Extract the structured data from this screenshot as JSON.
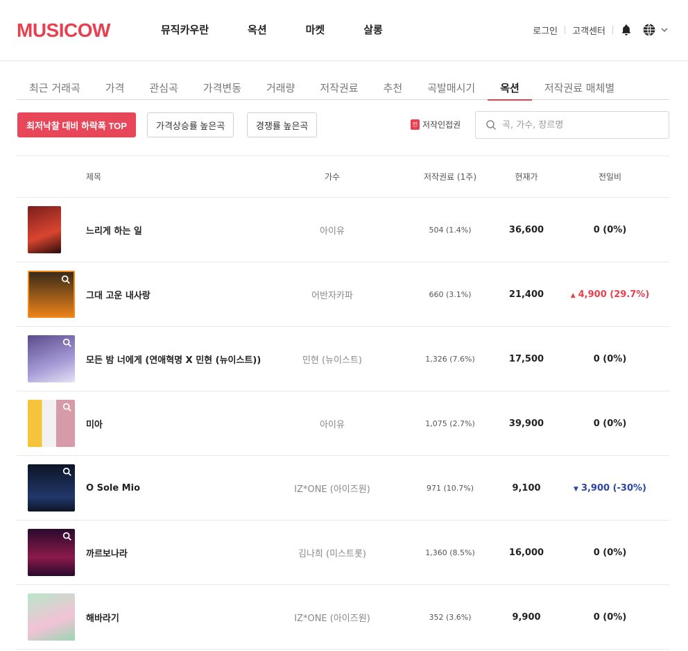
{
  "header": {
    "logo": "MUSICOW",
    "nav": [
      "뮤직카우란",
      "옥션",
      "마켓",
      "살롱"
    ],
    "util": {
      "login": "로그인",
      "support": "고객센터"
    }
  },
  "tabs": [
    {
      "label": "최근 거래곡",
      "active": false
    },
    {
      "label": "가격",
      "active": false
    },
    {
      "label": "관심곡",
      "active": false
    },
    {
      "label": "가격변동",
      "active": false
    },
    {
      "label": "거래량",
      "active": false
    },
    {
      "label": "저작권료",
      "active": false
    },
    {
      "label": "추천",
      "active": false
    },
    {
      "label": "곡발매시기",
      "active": false
    },
    {
      "label": "옥션",
      "active": true
    },
    {
      "label": "저작권료 매체별",
      "active": false
    }
  ],
  "filters": {
    "primary": "최저낙찰 대비 하락폭 TOP",
    "second": "가격상승률 높은곡",
    "third": "경쟁률 높은곡",
    "copyright_badge": "인",
    "copyright_label": "저작인접권"
  },
  "search": {
    "placeholder": "곡, 가수, 장르명"
  },
  "table": {
    "headers": {
      "title": "제목",
      "artist": "가수",
      "royalty": "저작권료 (1주)",
      "price": "현재가",
      "change": "전일비"
    },
    "rows": [
      {
        "title": "느리게 하는 일",
        "artist": "아이유",
        "royalty": "504 (1.4%)",
        "price": "36,600",
        "change": "0 (0%)",
        "dir": "flat"
      },
      {
        "title": "그대 고운 내사랑",
        "artist": "어반자카파",
        "royalty": "660 (3.1%)",
        "price": "21,400",
        "change": "4,900 (29.7%)",
        "dir": "up"
      },
      {
        "title": "모든 밤 너에게 (연애혁명 X 민현 (뉴이스트))",
        "artist": "민현 (뉴이스트)",
        "royalty": "1,326 (7.6%)",
        "price": "17,500",
        "change": "0 (0%)",
        "dir": "flat"
      },
      {
        "title": "미아",
        "artist": "아이유",
        "royalty": "1,075 (2.7%)",
        "price": "39,900",
        "change": "0 (0%)",
        "dir": "flat"
      },
      {
        "title": "O Sole Mio",
        "artist": "IZ*ONE (아이즈원)",
        "royalty": "971 (10.7%)",
        "price": "9,100",
        "change": "3,900 (-30%)",
        "dir": "down"
      },
      {
        "title": "까르보나라",
        "artist": "김나희 (미스트롯)",
        "royalty": "1,360 (8.5%)",
        "price": "16,000",
        "change": "0 (0%)",
        "dir": "flat"
      },
      {
        "title": "해바라기",
        "artist": "IZ*ONE (아이즈원)",
        "royalty": "352 (3.6%)",
        "price": "9,900",
        "change": "0 (0%)",
        "dir": "flat"
      }
    ]
  },
  "colors": {
    "accent": "#e8404f",
    "down": "#2c44a8"
  }
}
